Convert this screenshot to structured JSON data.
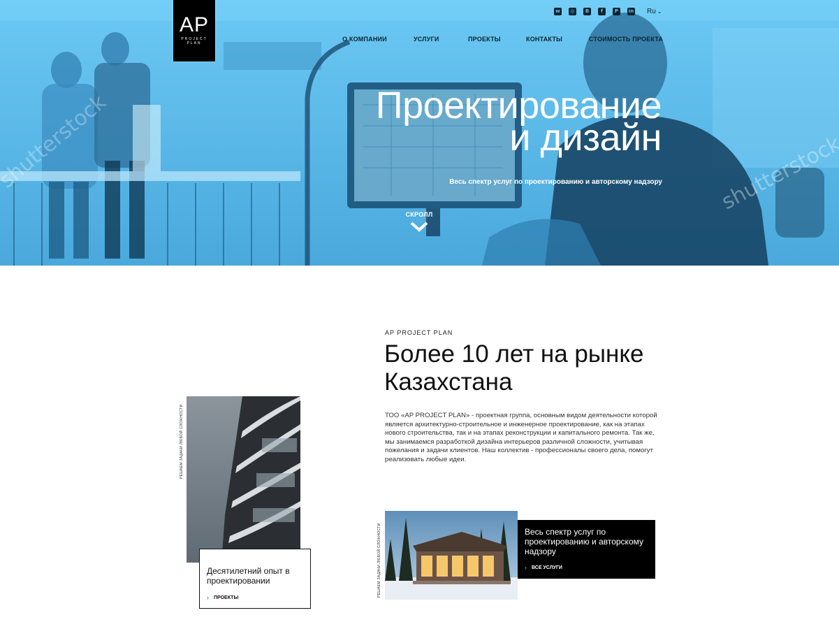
{
  "brand": {
    "logo_main": "AP",
    "logo_sub": "PROJECT PLAN"
  },
  "header": {
    "socials": [
      {
        "name": "whatsapp-icon",
        "glyph": "w"
      },
      {
        "name": "instagram-icon",
        "glyph": "◎"
      },
      {
        "name": "behance-icon",
        "glyph": "B"
      },
      {
        "name": "facebook-icon",
        "glyph": "f"
      },
      {
        "name": "pinterest-icon",
        "glyph": "P"
      },
      {
        "name": "linkedin-icon",
        "glyph": "in"
      }
    ],
    "language": "Ru",
    "language_icon": "chevron-down-icon"
  },
  "nav": {
    "items": [
      {
        "label": "О КОМПАНИИ"
      },
      {
        "label": "УСЛУГИ"
      },
      {
        "label": "ПРОЕКТЫ"
      },
      {
        "label": "КОНТАКТЫ"
      },
      {
        "label": "СТОИМОСТЬ ПРОЕКТА"
      }
    ]
  },
  "hero": {
    "title_line1": "Проектирование",
    "title_line2": "и дизайн",
    "subtitle": "Весь спектр услуг по проектированию и авторскому надзору",
    "scroll_label": "СКРОЛЛ",
    "scroll_icon": "chevron-down-icon",
    "watermark": "shutterstock",
    "colors": {
      "tint": "#4fb2e6",
      "text": "#ffffff"
    }
  },
  "about": {
    "eyebrow": "AP PROJECT PLAN",
    "title": "Более 10 лет на рынке Казахстана",
    "text": "ТОО «AP PROJECT PLAN» - проектная группа, основным видом деятельности которой является архитектурно-строительное и инженерное проектирование, как на этапах нового строительства, так и на этапах реконструкции и капитального ремонта. Так же, мы занимаемся разработкой дизайна интерьеров различной сложности, учитывая пожелания и задачи клиентов. Наш коллектив - профессионалы своего дела, помогут реализовать любые идеи."
  },
  "cards": [
    {
      "vertical_label": "РЕШАЕМ ЗАДАЧИ ЛЮБОЙ СЛОЖНОСТИ",
      "title": "Десятилетний опыт в проектировании",
      "link_label": "ПРОЕКТЫ",
      "link_icon": "chevron-right-icon"
    },
    {
      "vertical_label": "РЕШАЕМ ЗАДАЧИ ЛЮБОЙ СЛОЖНОСТИ",
      "title": "Весь спектр услуг по проектированию и авторскому надзору",
      "link_label": "ВСЕ УСЛУГИ",
      "link_icon": "chevron-right-icon"
    }
  ],
  "colors": {
    "accent": "#1f9fe0",
    "dark": "#000000"
  }
}
